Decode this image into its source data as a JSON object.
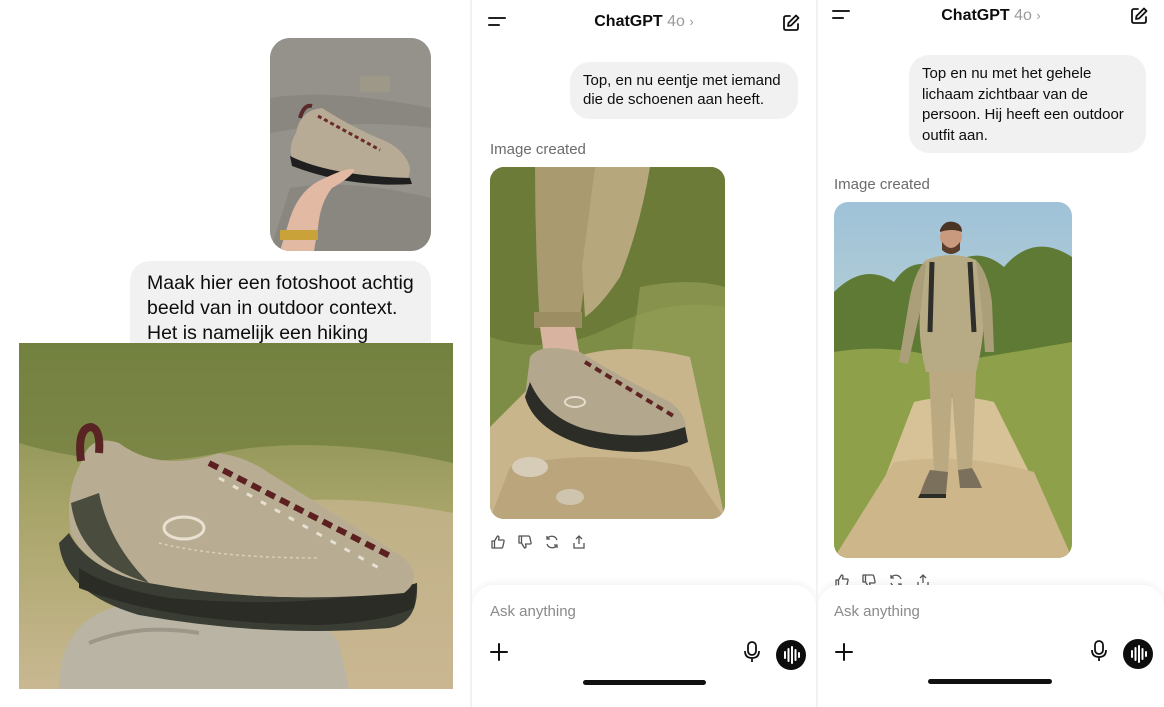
{
  "panel1": {
    "bubble_text": "Maak hier een fotoshoot achtig beeld van in outdoor context. Het is namelijk een hiking"
  },
  "panel2": {
    "header": {
      "title": "ChatGPT",
      "model": "4o",
      "chevron": "›"
    },
    "user_message": "Top, en nu eentje met iemand die de schoenen aan heeft.",
    "image_created_label": "Image created",
    "composer": {
      "placeholder": "Ask anything"
    }
  },
  "panel3": {
    "header": {
      "title": "ChatGPT",
      "model": "4o",
      "chevron": "›"
    },
    "user_message": "Top en nu met het gehele lichaam zichtbaar van de persoon. Hij heeft een outdoor outfit aan.",
    "image_created_label": "Image created",
    "composer": {
      "placeholder": "Ask anything"
    }
  },
  "icons": [
    "menu-icon",
    "edit-icon",
    "thumbs-up-icon",
    "thumbs-down-icon",
    "regenerate-icon",
    "share-icon",
    "plus-icon",
    "mic-icon",
    "voice-mode-icon"
  ],
  "colors": {
    "bubble": "#f1f1f1",
    "muted": "#9b9b9b",
    "voice_button": "#0d0d0d"
  }
}
